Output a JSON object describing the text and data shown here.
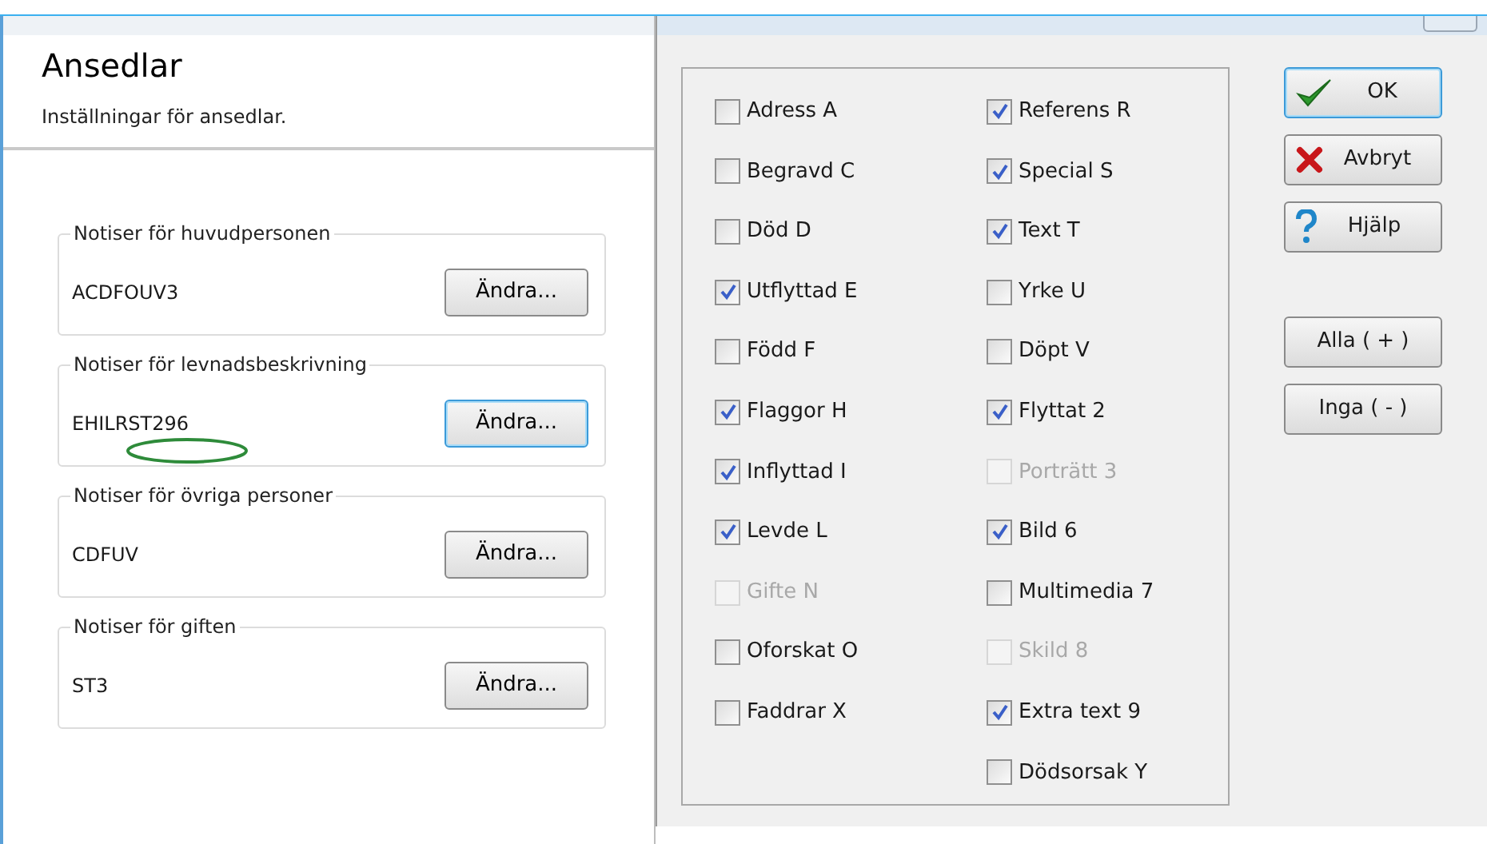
{
  "page": {
    "title": "Ansedlar",
    "subtitle": "Inställningar för ansedlar."
  },
  "groups": [
    {
      "legend": "Notiser för huvudpersonen",
      "value": "ACDFOUV3",
      "button": "Ändra...",
      "focused": false,
      "annotated": false
    },
    {
      "legend": "Notiser för levnadsbeskrivning",
      "value": "EHILRST296",
      "button": "Ändra...",
      "focused": true,
      "annotated": true
    },
    {
      "legend": "Notiser för övriga personer",
      "value": "CDFUV",
      "button": "Ändra...",
      "focused": false,
      "annotated": false
    },
    {
      "legend": "Notiser för giften",
      "value": "ST3",
      "button": "Ändra...",
      "focused": false,
      "annotated": false
    }
  ],
  "dialog": {
    "columns": [
      [
        {
          "label": "Adress A",
          "checked": false,
          "disabled": false
        },
        {
          "label": "Begravd C",
          "checked": false,
          "disabled": false
        },
        {
          "label": "Död D",
          "checked": false,
          "disabled": false
        },
        {
          "label": "Utflyttad E",
          "checked": true,
          "disabled": false
        },
        {
          "label": "Född F",
          "checked": false,
          "disabled": false
        },
        {
          "label": "Flaggor H",
          "checked": true,
          "disabled": false
        },
        {
          "label": "Inflyttad I",
          "checked": true,
          "disabled": false
        },
        {
          "label": "Levde L",
          "checked": true,
          "disabled": false
        },
        {
          "label": "Gifte N",
          "checked": false,
          "disabled": true
        },
        {
          "label": "Oforskat O",
          "checked": false,
          "disabled": false
        },
        {
          "label": "Faddrar X",
          "checked": false,
          "disabled": false
        }
      ],
      [
        {
          "label": "Referens R",
          "checked": true,
          "disabled": false
        },
        {
          "label": "Special S",
          "checked": true,
          "disabled": false
        },
        {
          "label": "Text T",
          "checked": true,
          "disabled": false
        },
        {
          "label": "Yrke U",
          "checked": false,
          "disabled": false
        },
        {
          "label": "Döpt V",
          "checked": false,
          "disabled": false
        },
        {
          "label": "Flyttat 2",
          "checked": true,
          "disabled": false
        },
        {
          "label": "Porträtt 3",
          "checked": false,
          "disabled": true
        },
        {
          "label": "Bild 6",
          "checked": true,
          "disabled": false
        },
        {
          "label": "Multimedia 7",
          "checked": false,
          "disabled": false
        },
        {
          "label": "Skild 8",
          "checked": false,
          "disabled": true
        },
        {
          "label": "Extra text 9",
          "checked": true,
          "disabled": false
        },
        {
          "label": "Dödsorsak Y",
          "checked": false,
          "disabled": false
        }
      ]
    ],
    "buttons": [
      {
        "label": "OK",
        "kind": "ok",
        "focused": true
      },
      {
        "label": "Avbryt",
        "kind": "cancel",
        "focused": false
      },
      {
        "label": "Hjälp",
        "kind": "help",
        "focused": false
      },
      {
        "label": "Alla ( + )",
        "kind": "plain",
        "focused": false
      },
      {
        "label": "Inga ( - )",
        "kind": "plain",
        "focused": false
      }
    ]
  }
}
